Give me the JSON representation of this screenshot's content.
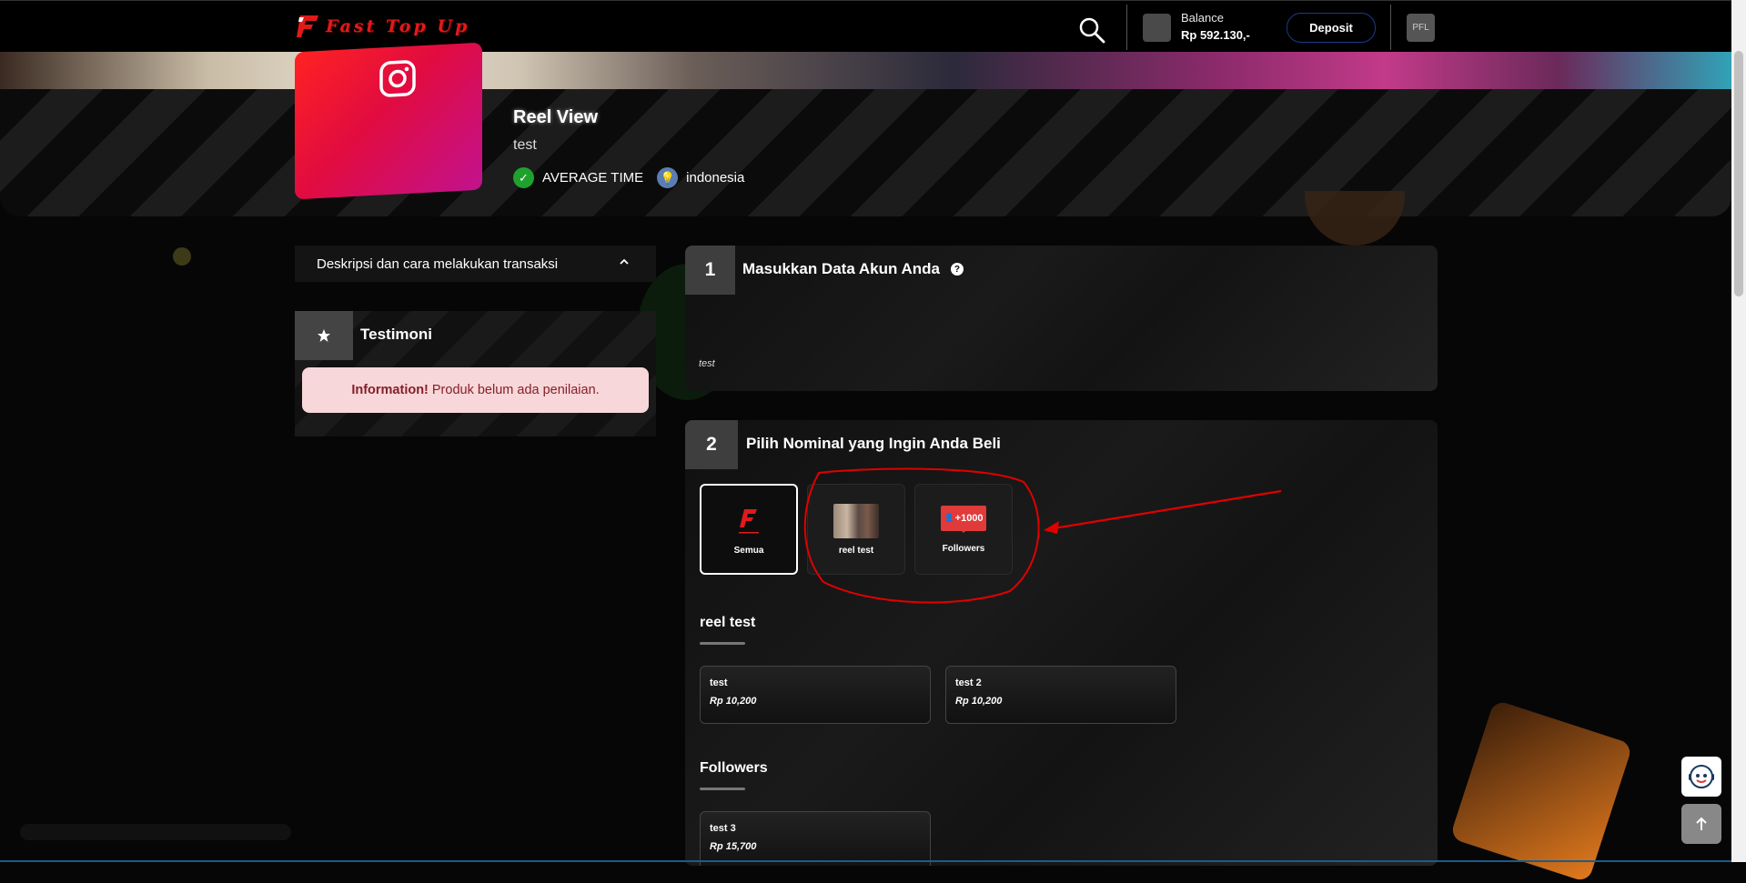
{
  "header": {
    "logo_text": "Fast Top Up",
    "balance_label": "Balance",
    "balance_value": "Rp 592.130,-",
    "deposit_label": "Deposit",
    "profile_label": "PFL"
  },
  "product": {
    "title": "Reel View",
    "subtitle": "test",
    "badge_time": "AVERAGE TIME",
    "badge_region": "indonesia"
  },
  "sidebar": {
    "description_toggle": "Deskripsi dan cara melakukan transaksi",
    "testimoni_title": "Testimoni",
    "alert_strong": "Information!",
    "alert_text": "Produk belum ada penilaian."
  },
  "step1": {
    "number": "1",
    "title": "Masukkan Data Akun Anda",
    "note": "test"
  },
  "step2": {
    "number": "2",
    "title": "Pilih Nominal yang Ingin Anda Beli",
    "categories": [
      {
        "label": "Semua"
      },
      {
        "label": "reel test"
      },
      {
        "label": "Followers",
        "thumb_text": "+1000"
      }
    ],
    "sections": [
      {
        "title": "reel test",
        "items": [
          {
            "name": "test",
            "price": "Rp 10,200"
          },
          {
            "name": "test 2",
            "price": "Rp 10,200"
          }
        ]
      },
      {
        "title": "Followers",
        "items": [
          {
            "name": "test 3",
            "price": "Rp 15,700"
          }
        ]
      }
    ]
  },
  "icons": {
    "search": "search-icon",
    "instagram": "instagram-icon",
    "check": "check-icon",
    "bulb": "bulb-icon",
    "star": "star-icon",
    "help": "help-icon",
    "chevron": "chevron-up-icon",
    "chat": "chat-bot-icon",
    "arrow_up": "arrow-up-icon"
  },
  "colors": {
    "accent_red": "#e01a1a",
    "alert_bg": "#f8d7da",
    "alert_text": "#842029",
    "deposit_border": "#1d3a8a",
    "annotation_red": "#e00000"
  }
}
